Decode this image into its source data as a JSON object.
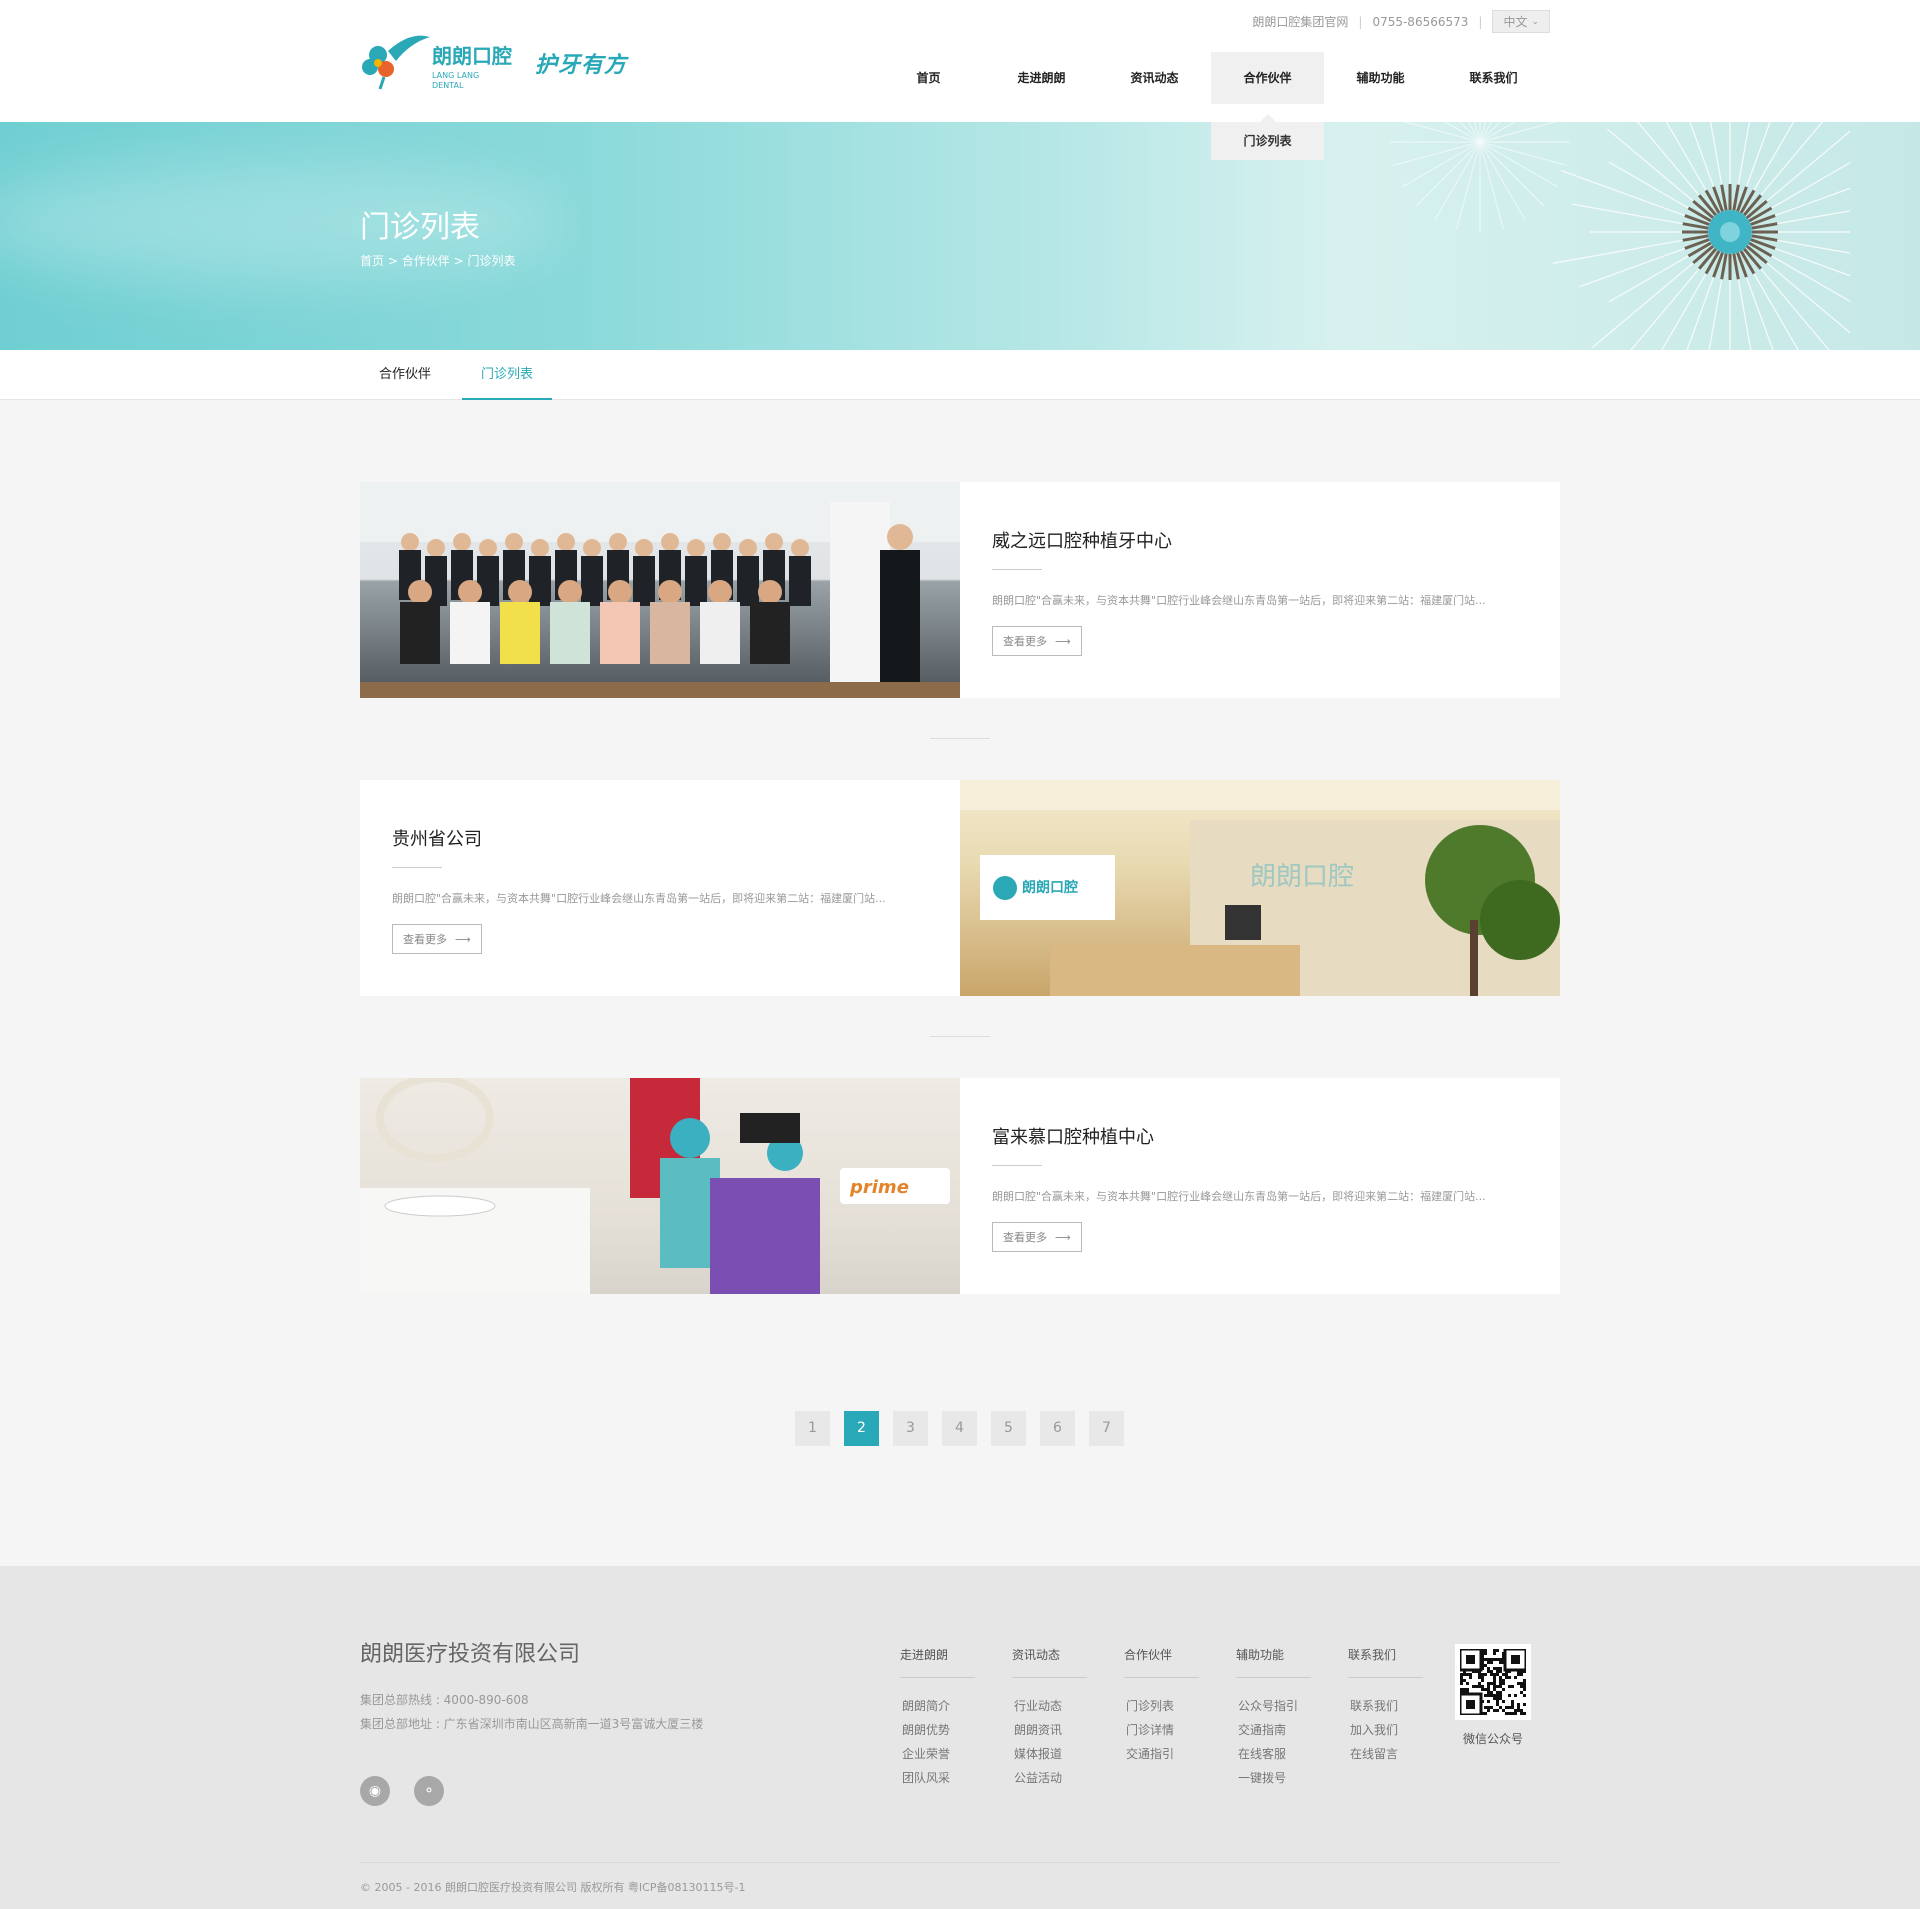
{
  "topbar": {
    "official_site": "朗朗口腔集团官网",
    "phone": "0755-86566573",
    "language": "中文"
  },
  "logo": {
    "cn": "朗朗口腔",
    "en1": "LANG LANG",
    "en2": "DENTAL",
    "slogan": "护牙有方"
  },
  "nav": {
    "items": [
      "首页",
      "走进朗朗",
      "资讯动态",
      "合作伙伴",
      "辅助功能",
      "联系我们"
    ],
    "dropdown_item": "门诊列表"
  },
  "banner": {
    "title": "门诊列表",
    "crumb_home": "首页",
    "crumb_sep": ">",
    "crumb_section": "合作伙伴",
    "crumb_current": "门诊列表"
  },
  "subnav": {
    "tabs": [
      "合作伙伴",
      "门诊列表"
    ]
  },
  "cards": [
    {
      "title": "威之远口腔种植牙中心",
      "desc": "朗朗口腔\"合赢未来，与资本共舞\"口腔行业峰会继山东青岛第一站后，即将迎来第二站：福建厦门站...",
      "more": "查看更多"
    },
    {
      "title": "贵州省公司",
      "desc": "朗朗口腔\"合赢未来，与资本共舞\"口腔行业峰会继山东青岛第一站后，即将迎来第二站：福建厦门站...",
      "more": "查看更多"
    },
    {
      "title": "富来慕口腔种植中心",
      "desc": "朗朗口腔\"合赢未来，与资本共舞\"口腔行业峰会继山东青岛第一站后，即将迎来第二站：福建厦门站...",
      "more": "查看更多"
    }
  ],
  "photo_text": {
    "prime": "prime"
  },
  "pagination": {
    "pages": [
      "1",
      "2",
      "3",
      "4",
      "5",
      "6",
      "7"
    ],
    "current": 2
  },
  "footer": {
    "company": "朗朗医疗投资有限公司",
    "hotline": "集团总部热线 : 4000-890-608",
    "address": "集团总部地址 :  广东省深圳市南山区高新南一道3号富诚大厦三楼",
    "columns": [
      {
        "heading": "走进朗朗",
        "links": [
          "朗朗简介",
          "朗朗优势",
          "企业荣誉",
          "团队风采"
        ]
      },
      {
        "heading": "资讯动态",
        "links": [
          "行业动态",
          "朗朗资讯",
          "媒体报道",
          "公益活动"
        ]
      },
      {
        "heading": "合作伙伴",
        "links": [
          "门诊列表",
          "门诊详情",
          "交通指引"
        ]
      },
      {
        "heading": "辅助功能",
        "links": [
          "公众号指引",
          "交通指南",
          "在线客服",
          "一键拨号"
        ]
      },
      {
        "heading": "联系我们",
        "links": [
          "联系我们",
          "加入我们",
          "在线留言"
        ]
      }
    ],
    "qr_caption": "微信公众号",
    "copyright": "© 2005 - 2016 朗朗口腔医疗投资有限公司 版权所有 粤ICP备08130115号-1"
  },
  "colors": {
    "accent": "#29a9b8",
    "footer_bg": "#e6e6e6",
    "page_bg": "#f5f5f5"
  }
}
